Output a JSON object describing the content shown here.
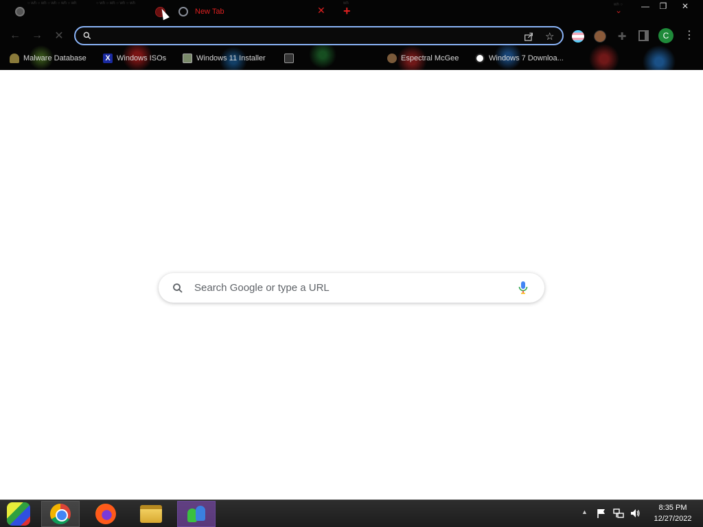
{
  "browser": {
    "tabs": [
      {
        "title": ""
      },
      {
        "title": "New Tab"
      }
    ],
    "omnibox": {
      "value": "",
      "placeholder": ""
    },
    "profile_initial": "C",
    "bookmarks": [
      {
        "label": "Malware Database"
      },
      {
        "label": "Windows ISOs",
        "icon_text": "X"
      },
      {
        "label": "Windows 11 Installer"
      },
      {
        "label": ""
      },
      {
        "label": "Espectral McGee"
      },
      {
        "label": "Windows 7 Downloa..."
      }
    ],
    "window_controls": {
      "minimize": "—",
      "restore": "❐",
      "close": "✕"
    },
    "theme": {
      "tab_text_color": "#e02020",
      "omnibox_border": "#8ab4f8"
    }
  },
  "new_tab_page": {
    "search_placeholder": "Search Google or type a URL"
  },
  "taskbar": {
    "apps": [
      "start",
      "chrome",
      "firefox",
      "file-explorer",
      "messenger"
    ],
    "clock": {
      "time": "8:35 PM",
      "date": "12/27/2022"
    }
  }
}
